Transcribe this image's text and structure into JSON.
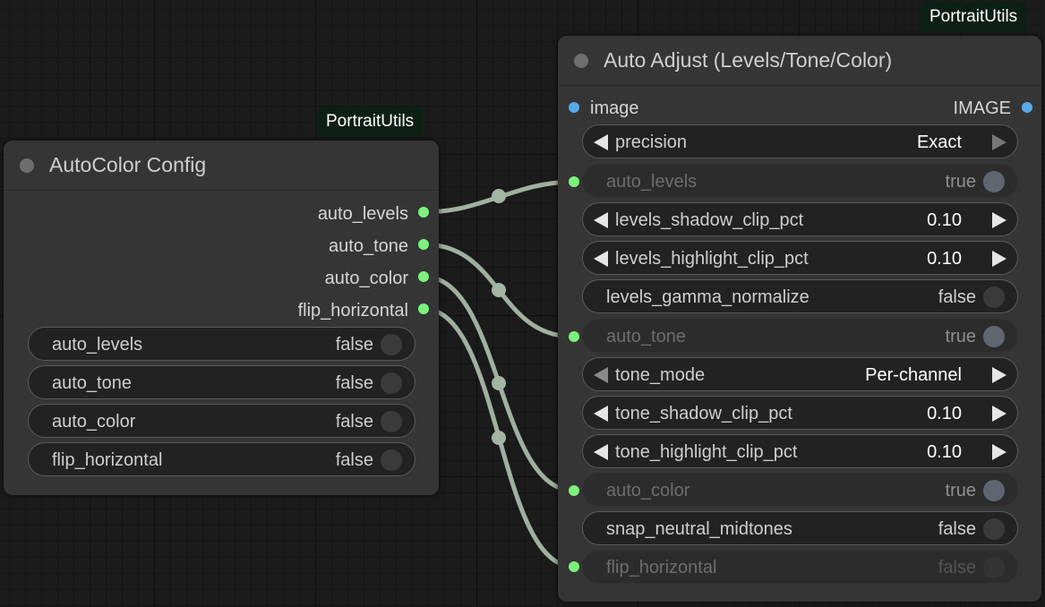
{
  "colors": {
    "wire": "#9fb09f",
    "slot_boolean": "#7cf27c",
    "slot_image": "#5aa9ea",
    "badge_bg": "#0d1f14"
  },
  "left_node": {
    "badge": "PortraitUtils",
    "title": "AutoColor Config",
    "outputs": [
      "auto_levels",
      "auto_tone",
      "auto_color",
      "flip_horizontal"
    ],
    "widgets": [
      {
        "name": "auto_levels",
        "value": "false"
      },
      {
        "name": "auto_tone",
        "value": "false"
      },
      {
        "name": "auto_color",
        "value": "false"
      },
      {
        "name": "flip_horizontal",
        "value": "false"
      }
    ]
  },
  "right_node": {
    "badge": "PortraitUtils",
    "title": "Auto Adjust (Levels/Tone/Color)",
    "input_image": "image",
    "output_image": "IMAGE",
    "rows": {
      "precision": {
        "name": "precision",
        "value": "Exact"
      },
      "auto_levels": {
        "name": "auto_levels",
        "value": "true"
      },
      "levels_shadow_clip_pct": {
        "name": "levels_shadow_clip_pct",
        "value": "0.10"
      },
      "levels_highlight_clip_pct": {
        "name": "levels_highlight_clip_pct",
        "value": "0.10"
      },
      "levels_gamma_normalize": {
        "name": "levels_gamma_normalize",
        "value": "false"
      },
      "auto_tone": {
        "name": "auto_tone",
        "value": "true"
      },
      "tone_mode": {
        "name": "tone_mode",
        "value": "Per-channel"
      },
      "tone_shadow_clip_pct": {
        "name": "tone_shadow_clip_pct",
        "value": "0.10"
      },
      "tone_highlight_clip_pct": {
        "name": "tone_highlight_clip_pct",
        "value": "0.10"
      },
      "auto_color": {
        "name": "auto_color",
        "value": "true"
      },
      "snap_neutral_midtones": {
        "name": "snap_neutral_midtones",
        "value": "false"
      },
      "flip_horizontal": {
        "name": "flip_horizontal",
        "value": "false"
      }
    }
  }
}
